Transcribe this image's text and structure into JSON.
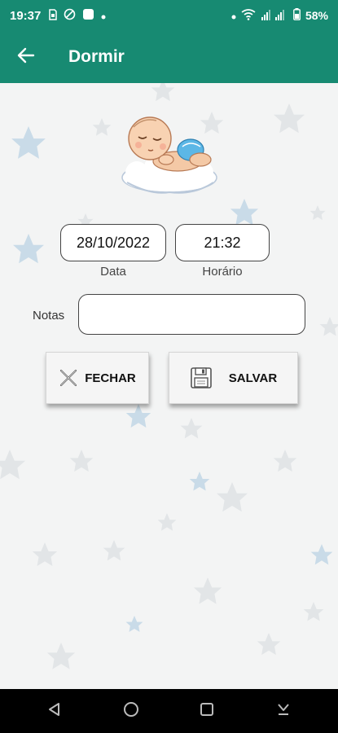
{
  "status_bar": {
    "time": "19:37",
    "battery": "58%",
    "icons": [
      "sim-card-icon",
      "no-data-icon",
      "square-app-icon",
      "dot-icon",
      "wifi-icon",
      "signal-icon",
      "battery-icon"
    ]
  },
  "app_bar": {
    "title": "Dormir",
    "back_icon": "arrow-back-icon"
  },
  "form": {
    "date_value": "28/10/2022",
    "date_label": "Data",
    "time_value": "21:32",
    "time_label": "Horário",
    "notes_label": "Notas",
    "notes_value": "",
    "notes_placeholder": ""
  },
  "buttons": {
    "close_label": "FECHAR",
    "close_icon": "close-x-icon",
    "save_label": "SALVAR",
    "save_icon": "floppy-disk-icon"
  },
  "colors": {
    "primary": "#178a72",
    "background": "#f3f4f4",
    "star_blue": "#c9dbe8",
    "star_gray": "#e2e5e7"
  },
  "nav_bar": {
    "icons": [
      "back-triangle-icon",
      "home-circle-icon",
      "recents-square-icon",
      "keyboard-hide-icon"
    ]
  }
}
